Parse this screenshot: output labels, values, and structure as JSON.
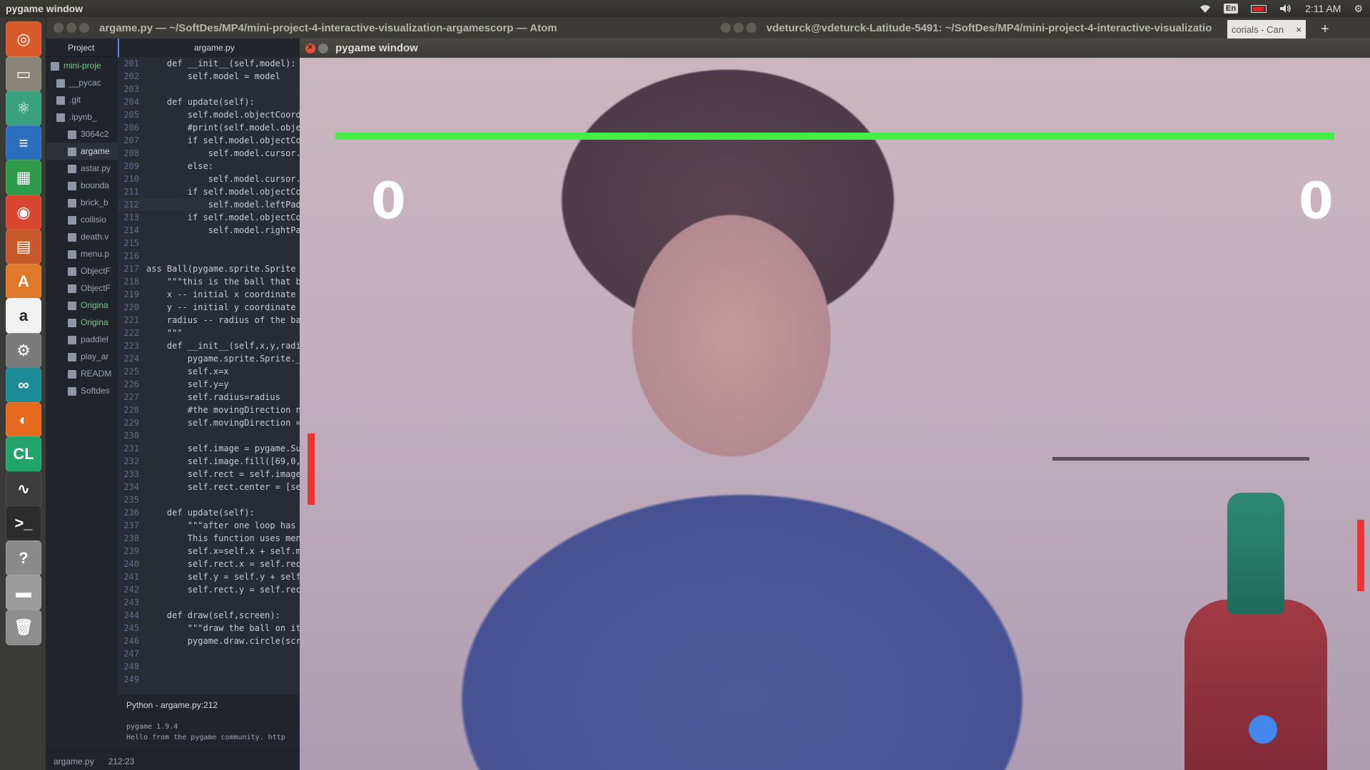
{
  "panel": {
    "app_title": "pygame window",
    "keyboard": "En",
    "time": "2:11 AM"
  },
  "atom": {
    "title": "argame.py — ~/SoftDes/MP4/mini-project-4-interactive-visualization-argamescorp — Atom",
    "tree_tab": "Project",
    "tree_items": [
      {
        "label": "mini-proje",
        "kind": "root"
      },
      {
        "label": "__pycac",
        "kind": "folder"
      },
      {
        "label": ".git",
        "kind": "folder"
      },
      {
        "label": ".ipynb_",
        "kind": "folder"
      },
      {
        "label": "3064c2",
        "kind": "image"
      },
      {
        "label": "argame",
        "kind": "file",
        "selected": true
      },
      {
        "label": "astar.py",
        "kind": "file"
      },
      {
        "label": "bounda",
        "kind": "file"
      },
      {
        "label": "brick_b",
        "kind": "file"
      },
      {
        "label": "collisio",
        "kind": "file"
      },
      {
        "label": "death.v",
        "kind": "file"
      },
      {
        "label": "menu.p",
        "kind": "file"
      },
      {
        "label": "ObjectF",
        "kind": "file"
      },
      {
        "label": "ObjectF",
        "kind": "file"
      },
      {
        "label": "Origina",
        "kind": "file-green"
      },
      {
        "label": "Origina",
        "kind": "file-green"
      },
      {
        "label": "paddlel",
        "kind": "file"
      },
      {
        "label": "play_ar",
        "kind": "file"
      },
      {
        "label": "READM",
        "kind": "file"
      },
      {
        "label": "Softdes",
        "kind": "file"
      }
    ],
    "editor_tab": "argame.py",
    "code_lines": [
      {
        "n": "201",
        "t": "    def __init__(self,model):"
      },
      {
        "n": "202",
        "t": "        self.model = model"
      },
      {
        "n": "203",
        "t": ""
      },
      {
        "n": "204",
        "t": "    def update(self):"
      },
      {
        "n": "205",
        "t": "        self.model.objectCoordi"
      },
      {
        "n": "206",
        "t": "        #print(self.model.objec"
      },
      {
        "n": "207",
        "t": "        if self.model.objectCoo"
      },
      {
        "n": "208",
        "t": "            self.model.cursor.u"
      },
      {
        "n": "209",
        "t": "        else:"
      },
      {
        "n": "210",
        "t": "            self.model.cursor.u"
      },
      {
        "n": "211",
        "t": "        if self.model.objectCoo"
      },
      {
        "n": "212",
        "t": "            self.model.leftPadd",
        "active": true
      },
      {
        "n": "213",
        "t": "        if self.model.objectCoo"
      },
      {
        "n": "214",
        "t": "            self.model.rightPad"
      },
      {
        "n": "215",
        "t": ""
      },
      {
        "n": "216",
        "t": ""
      },
      {
        "n": "217",
        "t": "ass Ball(pygame.sprite.Sprite"
      },
      {
        "n": "218",
        "t": "    \"\"\"this is the ball that bo"
      },
      {
        "n": "219",
        "t": "    x -- initial x coordinate o"
      },
      {
        "n": "220",
        "t": "    y -- initial y coordinate o"
      },
      {
        "n": "221",
        "t": "    radius -- radius of the bal"
      },
      {
        "n": "222",
        "t": "    \"\"\""
      },
      {
        "n": "223",
        "t": "    def __init__(self,x,y,radiu"
      },
      {
        "n": "224",
        "t": "        pygame.sprite.Sprite._"
      },
      {
        "n": "225",
        "t": "        self.x=x"
      },
      {
        "n": "226",
        "t": "        self.y=y"
      },
      {
        "n": "227",
        "t": "        self.radius=radius"
      },
      {
        "n": "228",
        "t": "        #the movingDirection ne"
      },
      {
        "n": "229",
        "t": "        self.movingDirection ="
      },
      {
        "n": "230",
        "t": ""
      },
      {
        "n": "231",
        "t": "        self.image = pygame.Sur"
      },
      {
        "n": "232",
        "t": "        self.image.fill([69,0,6"
      },
      {
        "n": "233",
        "t": "        self.rect = self.image."
      },
      {
        "n": "234",
        "t": "        self.rect.center = [sel"
      },
      {
        "n": "235",
        "t": ""
      },
      {
        "n": "236",
        "t": "    def update(self):"
      },
      {
        "n": "237",
        "t": "        \"\"\"after one loop has g"
      },
      {
        "n": "238",
        "t": "        This function uses menu"
      },
      {
        "n": "239",
        "t": "        self.x=self.x + self.mo"
      },
      {
        "n": "240",
        "t": "        self.rect.x = self.rect"
      },
      {
        "n": "241",
        "t": "        self.y = self.y + self."
      },
      {
        "n": "242",
        "t": "        self.rect.y = self.rect"
      },
      {
        "n": "243",
        "t": ""
      },
      {
        "n": "244",
        "t": "    def draw(self,screen):"
      },
      {
        "n": "245",
        "t": "        \"\"\"draw the ball on its"
      },
      {
        "n": "246",
        "t": "        pygame.draw.circle(scre"
      },
      {
        "n": "247",
        "t": ""
      },
      {
        "n": "248",
        "t": ""
      },
      {
        "n": "249",
        "t": ""
      }
    ],
    "status_python": "Python - argame.py:212",
    "console": [
      "pygame 1.9.4",
      "Hello from the pygame community. http"
    ],
    "bottom_file": "argame.py",
    "bottom_pos": "212:23"
  },
  "terminal": {
    "title": "vdeturck@vdeturck-Latitude-5491: ~/SoftDes/MP4/mini-project-4-interactive-visualizatio"
  },
  "browser": {
    "tab_label": "corials - Can",
    "close": "×",
    "plus": "+"
  },
  "pygame": {
    "title": "pygame window",
    "score_left": "0",
    "score_right": "0",
    "colors": {
      "paddle_horizontal": "#44ee44",
      "paddle_vertical": "#ee3333",
      "ball": "#4488ee",
      "score": "#ffffff"
    }
  },
  "launcher": [
    {
      "name": "ubuntu-dash-icon",
      "color": "#d95a2b",
      "glyph": "◎"
    },
    {
      "name": "files-icon",
      "color": "#8a8478",
      "glyph": "▭"
    },
    {
      "name": "atom-icon",
      "color": "#3aa17e",
      "glyph": "⚛"
    },
    {
      "name": "writer-icon",
      "color": "#2a6ebd",
      "glyph": "≡"
    },
    {
      "name": "calc-icon",
      "color": "#2e9b4a",
      "glyph": "▦"
    },
    {
      "name": "chrome-icon",
      "color": "#d8462f",
      "glyph": "◉"
    },
    {
      "name": "impress-icon",
      "color": "#c7582a",
      "glyph": "▤"
    },
    {
      "name": "software-center-icon",
      "color": "#e07a2a",
      "glyph": "A"
    },
    {
      "name": "amazon-icon",
      "color": "#f2f2f2",
      "glyph": "a"
    },
    {
      "name": "system-settings-icon",
      "color": "#7a7a7a",
      "glyph": "⚙"
    },
    {
      "name": "arduino-icon",
      "color": "#1d8a98",
      "glyph": "∞"
    },
    {
      "name": "firefox-icon",
      "color": "#e66a1d",
      "glyph": "◐"
    },
    {
      "name": "clion-icon",
      "color": "#21a46b",
      "glyph": "CL"
    },
    {
      "name": "system-monitor-icon",
      "color": "#3c3c3c",
      "glyph": "∿"
    },
    {
      "name": "terminal-icon",
      "color": "#2c2c2c",
      "glyph": ">_"
    },
    {
      "name": "help-icon",
      "color": "#8a8a8a",
      "glyph": "?"
    },
    {
      "name": "drive-icon",
      "color": "#9a9a9a",
      "glyph": "▬"
    },
    {
      "name": "trash-icon",
      "color": "#8d8d8d",
      "glyph": "🗑"
    }
  ]
}
